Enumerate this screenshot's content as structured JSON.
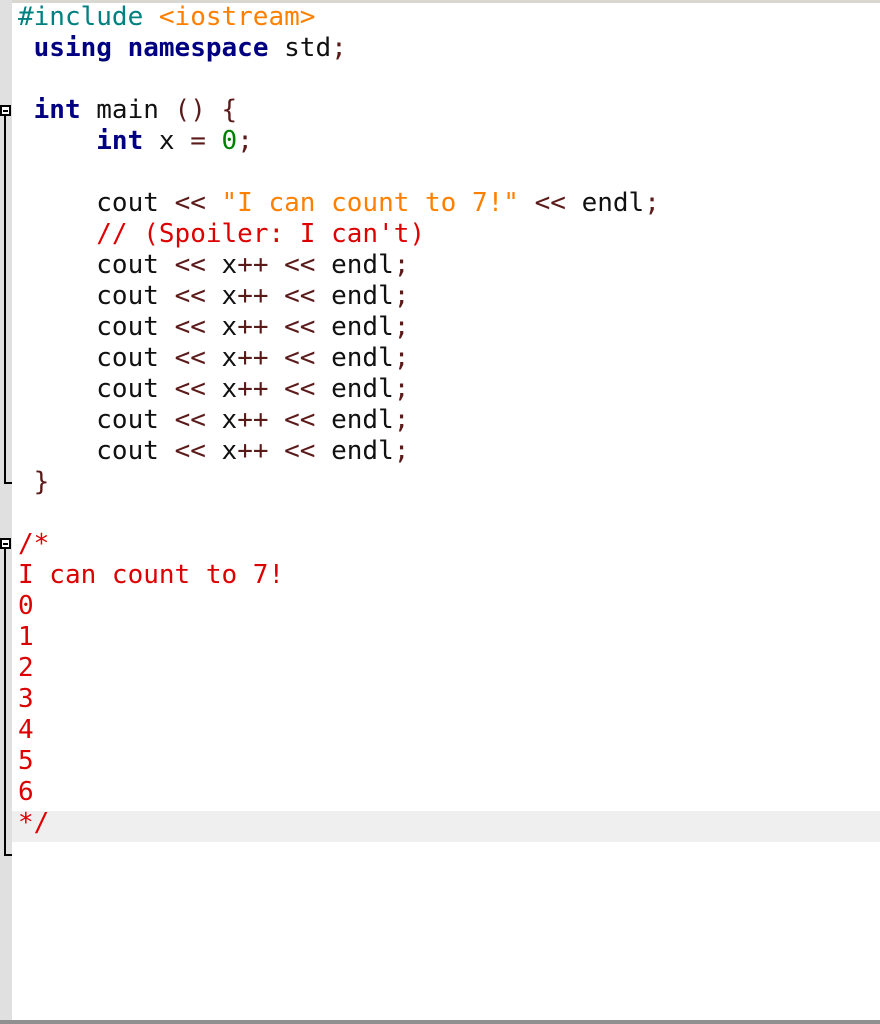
{
  "editor": {
    "language": "C++",
    "current_line_index": 26,
    "colors": {
      "keyword": "#000080",
      "preprocessor": "#008080",
      "string": "#ff8000",
      "number": "#008000",
      "operator": "#5a1a1a",
      "comment": "#dd0000",
      "identifier": "#111111",
      "gutter": "#e0e0e0",
      "current_line": "#efefef"
    },
    "lines": [
      {
        "indent": "",
        "tokens": [
          {
            "t": "pre",
            "v": "#include "
          },
          {
            "t": "str",
            "v": "<iostream>"
          }
        ]
      },
      {
        "indent": " ",
        "tokens": [
          {
            "t": "kw",
            "v": "using"
          },
          {
            "t": "id",
            "v": " "
          },
          {
            "t": "kw",
            "v": "namespace"
          },
          {
            "t": "id",
            "v": " std"
          },
          {
            "t": "op",
            "v": ";"
          }
        ]
      },
      {
        "indent": "",
        "tokens": []
      },
      {
        "indent": " ",
        "tokens": [
          {
            "t": "kw",
            "v": "int"
          },
          {
            "t": "id",
            "v": " main "
          },
          {
            "t": "op",
            "v": "()"
          },
          {
            "t": "id",
            "v": " "
          },
          {
            "t": "op",
            "v": "{"
          }
        ]
      },
      {
        "indent": "     ",
        "tokens": [
          {
            "t": "kw",
            "v": "int"
          },
          {
            "t": "id",
            "v": " x "
          },
          {
            "t": "op",
            "v": "="
          },
          {
            "t": "id",
            "v": " "
          },
          {
            "t": "num",
            "v": "0"
          },
          {
            "t": "op",
            "v": ";"
          }
        ]
      },
      {
        "indent": "",
        "tokens": []
      },
      {
        "indent": "     ",
        "tokens": [
          {
            "t": "id",
            "v": "cout "
          },
          {
            "t": "op",
            "v": "<<"
          },
          {
            "t": "id",
            "v": " "
          },
          {
            "t": "str",
            "v": "\"I can count to 7!\""
          },
          {
            "t": "id",
            "v": " "
          },
          {
            "t": "op",
            "v": "<<"
          },
          {
            "t": "id",
            "v": " endl"
          },
          {
            "t": "op",
            "v": ";"
          }
        ]
      },
      {
        "indent": "     ",
        "tokens": [
          {
            "t": "cmt",
            "v": "// (Spoiler: I can't)"
          }
        ]
      },
      {
        "indent": "     ",
        "tokens": [
          {
            "t": "id",
            "v": "cout "
          },
          {
            "t": "op",
            "v": "<<"
          },
          {
            "t": "id",
            "v": " x"
          },
          {
            "t": "op",
            "v": "++"
          },
          {
            "t": "id",
            "v": " "
          },
          {
            "t": "op",
            "v": "<<"
          },
          {
            "t": "id",
            "v": " endl"
          },
          {
            "t": "op",
            "v": ";"
          }
        ]
      },
      {
        "indent": "     ",
        "tokens": [
          {
            "t": "id",
            "v": "cout "
          },
          {
            "t": "op",
            "v": "<<"
          },
          {
            "t": "id",
            "v": " x"
          },
          {
            "t": "op",
            "v": "++"
          },
          {
            "t": "id",
            "v": " "
          },
          {
            "t": "op",
            "v": "<<"
          },
          {
            "t": "id",
            "v": " endl"
          },
          {
            "t": "op",
            "v": ";"
          }
        ]
      },
      {
        "indent": "     ",
        "tokens": [
          {
            "t": "id",
            "v": "cout "
          },
          {
            "t": "op",
            "v": "<<"
          },
          {
            "t": "id",
            "v": " x"
          },
          {
            "t": "op",
            "v": "++"
          },
          {
            "t": "id",
            "v": " "
          },
          {
            "t": "op",
            "v": "<<"
          },
          {
            "t": "id",
            "v": " endl"
          },
          {
            "t": "op",
            "v": ";"
          }
        ]
      },
      {
        "indent": "     ",
        "tokens": [
          {
            "t": "id",
            "v": "cout "
          },
          {
            "t": "op",
            "v": "<<"
          },
          {
            "t": "id",
            "v": " x"
          },
          {
            "t": "op",
            "v": "++"
          },
          {
            "t": "id",
            "v": " "
          },
          {
            "t": "op",
            "v": "<<"
          },
          {
            "t": "id",
            "v": " endl"
          },
          {
            "t": "op",
            "v": ";"
          }
        ]
      },
      {
        "indent": "     ",
        "tokens": [
          {
            "t": "id",
            "v": "cout "
          },
          {
            "t": "op",
            "v": "<<"
          },
          {
            "t": "id",
            "v": " x"
          },
          {
            "t": "op",
            "v": "++"
          },
          {
            "t": "id",
            "v": " "
          },
          {
            "t": "op",
            "v": "<<"
          },
          {
            "t": "id",
            "v": " endl"
          },
          {
            "t": "op",
            "v": ";"
          }
        ]
      },
      {
        "indent": "     ",
        "tokens": [
          {
            "t": "id",
            "v": "cout "
          },
          {
            "t": "op",
            "v": "<<"
          },
          {
            "t": "id",
            "v": " x"
          },
          {
            "t": "op",
            "v": "++"
          },
          {
            "t": "id",
            "v": " "
          },
          {
            "t": "op",
            "v": "<<"
          },
          {
            "t": "id",
            "v": " endl"
          },
          {
            "t": "op",
            "v": ";"
          }
        ]
      },
      {
        "indent": "     ",
        "tokens": [
          {
            "t": "id",
            "v": "cout "
          },
          {
            "t": "op",
            "v": "<<"
          },
          {
            "t": "id",
            "v": " x"
          },
          {
            "t": "op",
            "v": "++"
          },
          {
            "t": "id",
            "v": " "
          },
          {
            "t": "op",
            "v": "<<"
          },
          {
            "t": "id",
            "v": " endl"
          },
          {
            "t": "op",
            "v": ";"
          }
        ]
      },
      {
        "indent": " ",
        "tokens": [
          {
            "t": "op",
            "v": "}"
          }
        ]
      },
      {
        "indent": "",
        "tokens": []
      },
      {
        "indent": "",
        "tokens": [
          {
            "t": "cmt",
            "v": "/*"
          }
        ]
      },
      {
        "indent": "",
        "tokens": [
          {
            "t": "cmt",
            "v": "I can count to 7!"
          }
        ]
      },
      {
        "indent": "",
        "tokens": [
          {
            "t": "cmt",
            "v": "0"
          }
        ]
      },
      {
        "indent": "",
        "tokens": [
          {
            "t": "cmt",
            "v": "1"
          }
        ]
      },
      {
        "indent": "",
        "tokens": [
          {
            "t": "cmt",
            "v": "2"
          }
        ]
      },
      {
        "indent": "",
        "tokens": [
          {
            "t": "cmt",
            "v": "3"
          }
        ]
      },
      {
        "indent": "",
        "tokens": [
          {
            "t": "cmt",
            "v": "4"
          }
        ]
      },
      {
        "indent": "",
        "tokens": [
          {
            "t": "cmt",
            "v": "5"
          }
        ]
      },
      {
        "indent": "",
        "tokens": [
          {
            "t": "cmt",
            "v": "6"
          }
        ]
      },
      {
        "indent": "",
        "tokens": [
          {
            "t": "cmt",
            "v": "*/"
          }
        ]
      }
    ]
  }
}
